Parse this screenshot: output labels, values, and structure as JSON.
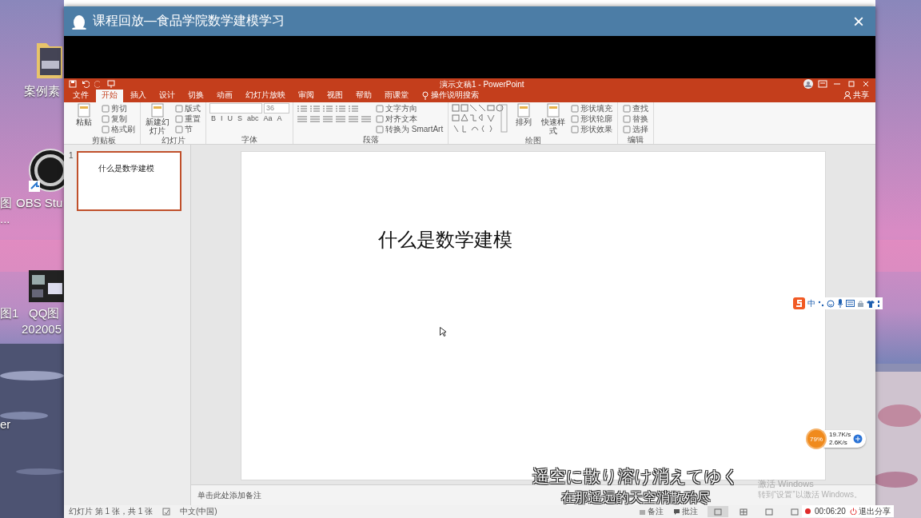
{
  "desktop": {
    "icons": [
      {
        "kind": "folder",
        "lines": [
          "案例素"
        ]
      },
      {
        "kind": "label",
        "lines": [
          "图",
          "..."
        ]
      },
      {
        "kind": "app",
        "lines": [
          "OBS Stu"
        ]
      },
      {
        "kind": "label",
        "lines": [
          "图1"
        ]
      },
      {
        "lines": [
          "QQ图",
          "202005"
        ]
      },
      {
        "kind": "label",
        "lines": [
          "er"
        ]
      }
    ]
  },
  "window": {
    "title": "课程回放—食品学院数学建模学习",
    "close": "×"
  },
  "powerpoint": {
    "doc_title": "演示文稿1 - PowerPoint",
    "tabs": [
      {
        "label": "文件",
        "selected": false
      },
      {
        "label": "开始",
        "selected": true
      },
      {
        "label": "插入",
        "selected": false
      },
      {
        "label": "设计",
        "selected": false
      },
      {
        "label": "切换",
        "selected": false
      },
      {
        "label": "动画",
        "selected": false
      },
      {
        "label": "幻灯片放映",
        "selected": false
      },
      {
        "label": "审阅",
        "selected": false
      },
      {
        "label": "视图",
        "selected": false
      },
      {
        "label": "帮助",
        "selected": false
      },
      {
        "label": "雨课堂",
        "selected": false
      }
    ],
    "tell_me": "操作说明搜索",
    "share": "共享",
    "ribbon": [
      {
        "label": "剪贴板",
        "items": [
          {
            "kind": "large",
            "label": "粘贴"
          },
          {
            "kind": "small",
            "label": "剪切"
          },
          {
            "kind": "small",
            "label": "复制"
          },
          {
            "kind": "small",
            "label": "格式刷"
          }
        ]
      },
      {
        "label": "幻灯片",
        "items": [
          {
            "kind": "large",
            "label": "新建幻灯片"
          },
          {
            "kind": "small",
            "label": "版式"
          },
          {
            "kind": "small",
            "label": "重置"
          },
          {
            "kind": "small",
            "label": "节"
          }
        ]
      },
      {
        "label": "字体",
        "items": [
          {
            "kind": "fontbox",
            "size": "36"
          },
          {
            "kind": "glyphs",
            "labels": [
              "B",
              "I",
              "U",
              "S",
              "abc",
              "Aa",
              "A"
            ]
          }
        ]
      },
      {
        "label": "段落",
        "items": [
          {
            "kind": "list_tools"
          },
          {
            "kind": "align_tools"
          },
          {
            "kind": "small",
            "label": "文字方向"
          },
          {
            "kind": "small",
            "label": "对齐文本"
          },
          {
            "kind": "small",
            "label": "转换为 SmartArt"
          }
        ]
      },
      {
        "label": "绘图",
        "items": [
          {
            "kind": "shapes"
          },
          {
            "kind": "large",
            "label": "排列"
          },
          {
            "kind": "large",
            "label": "快速样式"
          },
          {
            "kind": "small",
            "label": "形状填充"
          },
          {
            "kind": "small",
            "label": "形状轮廓"
          },
          {
            "kind": "small",
            "label": "形状效果"
          }
        ]
      },
      {
        "label": "编辑",
        "items": [
          {
            "kind": "small",
            "label": "查找"
          },
          {
            "kind": "small",
            "label": "替换"
          },
          {
            "kind": "small",
            "label": "选择"
          }
        ]
      }
    ],
    "thumbnails": [
      {
        "number": "1",
        "title": "什么是数学建模",
        "selected": true
      }
    ],
    "slide": {
      "title": "什么是数学建模"
    },
    "notes": {
      "placeholder": "单击此处添加备注"
    },
    "status_bar": {
      "slide_info": "幻灯片 第 1 张，共 1 张",
      "language": "中文(中国)",
      "notes": "备注",
      "comments": "批注",
      "views": [
        {
          "selected": true
        },
        {
          "selected": false
        },
        {
          "selected": false
        },
        {
          "selected": false
        }
      ]
    }
  },
  "overlays": {
    "ime": {
      "mode": "中"
    },
    "net_monitor": {
      "percent": "79%",
      "upload": "19.7K/s",
      "download": "2.6K/s"
    },
    "subtitles": [
      "遥空に散り溶け消えてゆく",
      "在那遥远的天空消散殆尽"
    ],
    "activation": {
      "title": "激活 Windows",
      "hint": "转到“设置”以激活 Windows。"
    },
    "recording": {
      "time": "00:06:20",
      "exit": "退出分享"
    }
  }
}
